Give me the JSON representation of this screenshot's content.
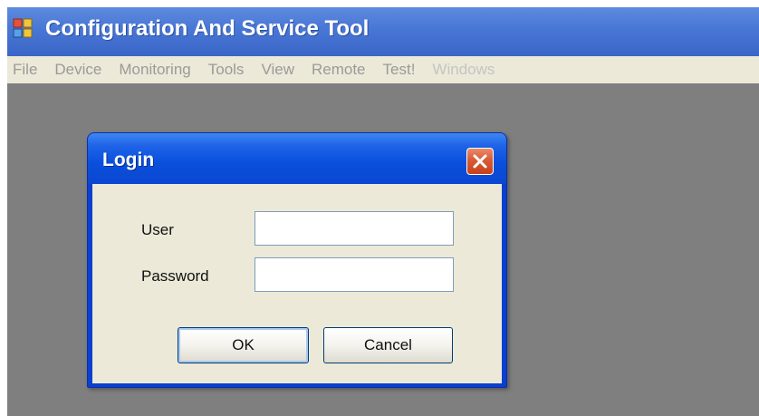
{
  "window": {
    "title": "Configuration And Service Tool",
    "icon": "app-window-icon"
  },
  "menu": {
    "items": [
      {
        "label": "File",
        "enabled": true
      },
      {
        "label": "Device",
        "enabled": true
      },
      {
        "label": "Monitoring",
        "enabled": true
      },
      {
        "label": "Tools",
        "enabled": true
      },
      {
        "label": "View",
        "enabled": true
      },
      {
        "label": "Remote",
        "enabled": true
      },
      {
        "label": "Test!",
        "enabled": true
      },
      {
        "label": "Windows",
        "enabled": false
      }
    ]
  },
  "dialog": {
    "title": "Login",
    "close_icon": "close-icon",
    "user_label": "User",
    "user_value": "",
    "password_label": "Password",
    "password_value": "",
    "ok_label": "OK",
    "cancel_label": "Cancel"
  },
  "colors": {
    "titlebar": "#4a78d6",
    "dialog_frame": "#0a47d0",
    "close_button": "#d95a33",
    "mdi_background": "#7f7f7f",
    "menubar": "#ece9d8"
  }
}
